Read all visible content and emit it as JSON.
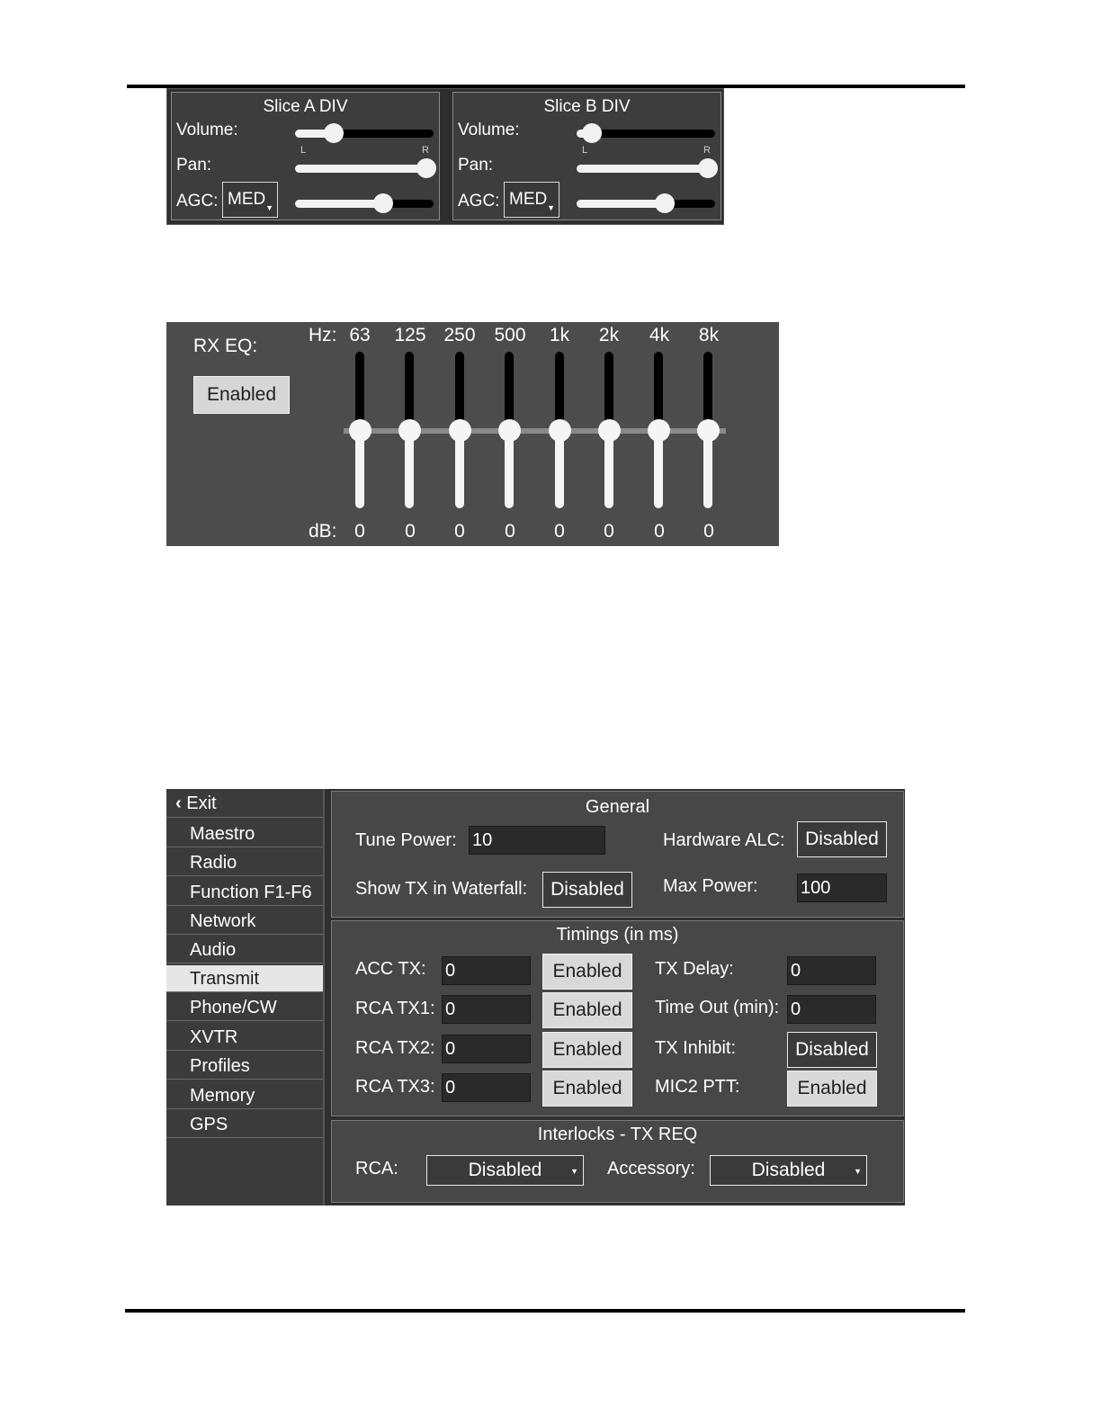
{
  "slices": [
    {
      "title": "Slice A DIV",
      "volume_label": "Volume:",
      "pan_label": "Pan:",
      "pan_left": "L",
      "pan_right": "R",
      "agc_label": "AGC:",
      "agc_value": "MED",
      "volume_level": 0.28,
      "pan_level": 1.0,
      "agc_level": 0.64
    },
    {
      "title": "Slice B DIV",
      "volume_label": "Volume:",
      "pan_label": "Pan:",
      "pan_left": "L",
      "pan_right": "R",
      "agc_label": "AGC:",
      "agc_value": "MED",
      "volume_level": 0.1,
      "pan_level": 1.0,
      "agc_level": 0.64
    }
  ],
  "rx_eq": {
    "title": "RX EQ:",
    "enabled_label": "Enabled",
    "hz_label": "Hz:",
    "db_label": "dB:",
    "bands": [
      {
        "hz": "63",
        "db": "0"
      },
      {
        "hz": "125",
        "db": "0"
      },
      {
        "hz": "250",
        "db": "0"
      },
      {
        "hz": "500",
        "db": "0"
      },
      {
        "hz": "1k",
        "db": "0"
      },
      {
        "hz": "2k",
        "db": "0"
      },
      {
        "hz": "4k",
        "db": "0"
      },
      {
        "hz": "8k",
        "db": "0"
      }
    ]
  },
  "sidebar": {
    "exit_label": "Exit",
    "items": [
      "Maestro",
      "Radio",
      "Function F1-F6",
      "Network",
      "Audio",
      "Transmit",
      "Phone/CW",
      "XVTR",
      "Profiles",
      "Memory",
      "GPS"
    ],
    "active": "Transmit"
  },
  "general": {
    "title": "General",
    "tune_power_label": "Tune Power:",
    "tune_power_value": "10",
    "hardware_alc_label": "Hardware ALC:",
    "hardware_alc_value": "Disabled",
    "show_tx_label": "Show TX in Waterfall:",
    "show_tx_value": "Disabled",
    "max_power_label": "Max Power:",
    "max_power_value": "100"
  },
  "timings": {
    "title": "Timings (in ms)",
    "acc_tx_label": "ACC TX:",
    "acc_tx_value": "0",
    "acc_tx_state": "Enabled",
    "rca_tx1_label": "RCA TX1:",
    "rca_tx1_value": "0",
    "rca_tx1_state": "Enabled",
    "rca_tx2_label": "RCA TX2:",
    "rca_tx2_value": "0",
    "rca_tx2_state": "Enabled",
    "rca_tx3_label": "RCA TX3:",
    "rca_tx3_value": "0",
    "rca_tx3_state": "Enabled",
    "tx_delay_label": "TX Delay:",
    "tx_delay_value": "0",
    "time_out_label": "Time Out (min):",
    "time_out_value": "0",
    "tx_inhibit_label": "TX Inhibit:",
    "tx_inhibit_value": "Disabled",
    "mic2_ptt_label": "MIC2 PTT:",
    "mic2_ptt_value": "Enabled"
  },
  "interlocks": {
    "title": "Interlocks - TX REQ",
    "rca_label": "RCA:",
    "rca_value": "Disabled",
    "accessory_label": "Accessory:",
    "accessory_value": "Disabled"
  }
}
